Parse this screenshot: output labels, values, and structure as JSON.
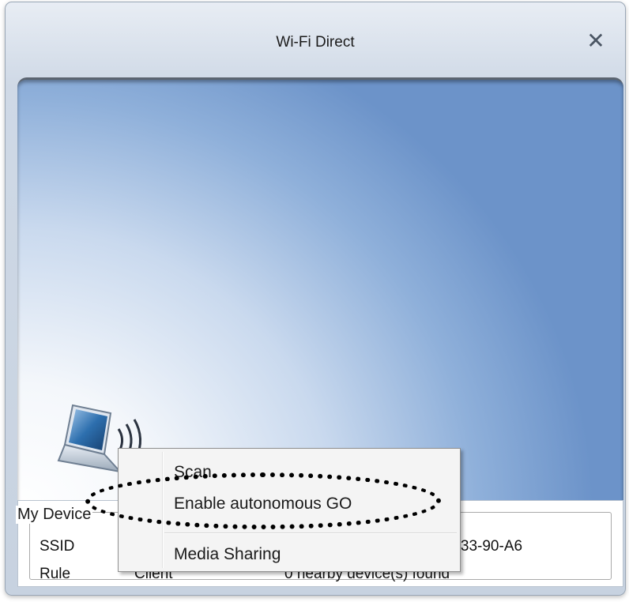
{
  "window": {
    "title": "Wi-Fi Direct",
    "close_glyph": "✕"
  },
  "device": {
    "legend": "My Device",
    "rows": [
      {
        "label": "SSID",
        "value": "3-33-90-A6"
      },
      {
        "label": "Rule",
        "value": "0 nearby device(s) found"
      }
    ],
    "rule_value_partial": "Client"
  },
  "context_menu": {
    "items": [
      {
        "label": "Scan"
      },
      {
        "label": "Enable autonomous GO"
      },
      {
        "label": "Media Sharing"
      }
    ]
  },
  "icons": {
    "laptop": "laptop-wireless-icon"
  },
  "colors": {
    "accent_blue": "#6c93c9",
    "highlight_outline": "#000000"
  }
}
